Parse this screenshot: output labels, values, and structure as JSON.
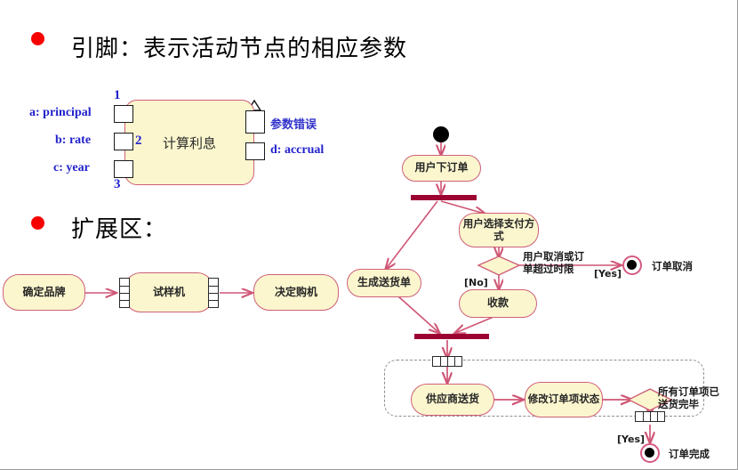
{
  "slide": {
    "heading_pin": "引脚：表示活动节点的相应参数",
    "heading_region": "扩展区："
  },
  "colors": {
    "node_fill": "#fbf6ce",
    "node_border": "#cf5f78",
    "flow": "#cf5575",
    "bar": "#9c0232",
    "bullet": "#f80000",
    "pin_label": "#2222cc",
    "region_border": "#8e8e8e"
  },
  "pin_example": {
    "activity_label": "计算利息",
    "input_pins": [
      {
        "label": "a: principal",
        "number": "1",
        "icon": "arrow-right-icon"
      },
      {
        "label": "b: rate",
        "number": "2",
        "icon": "arrow-right-icon"
      },
      {
        "label": "c: year",
        "number": "3",
        "icon": "arrow-right-icon"
      }
    ],
    "output_pins": [
      {
        "label": "参数错误",
        "icon": "exception-pin-icon"
      },
      {
        "label": "d: accrual",
        "icon": "arrow-right-icon"
      }
    ]
  },
  "expansion_example": {
    "nodes": [
      {
        "label": "确定品牌"
      },
      {
        "label": "试样机"
      },
      {
        "label": "决定购机"
      }
    ]
  },
  "activity_diagram": {
    "initial_node": "initial-node-icon",
    "nodes": [
      {
        "id": "order",
        "label": "用户下订单"
      },
      {
        "id": "pay_select",
        "label": "用户选择支付方式"
      },
      {
        "id": "delivery_note",
        "label": "生成送货单"
      },
      {
        "id": "collect",
        "label": "收款"
      },
      {
        "id": "supplier_deliver",
        "label": "供应商送货"
      },
      {
        "id": "update_item",
        "label": "修改订单项状态"
      }
    ],
    "decisions": [
      {
        "id": "cancel_or_timeout",
        "note": "用户取消或订单超过时限",
        "note_line1": "用户取消或订",
        "note_line2": "单超过时限",
        "yes": "[Yes]",
        "no": "[No]"
      },
      {
        "id": "all_delivered",
        "note": "所有订单项已送货完毕",
        "note_line1": "所有订单项已",
        "note_line2": "送货完毕",
        "yes": "[Yes]"
      }
    ],
    "final_nodes": [
      {
        "id": "order_cancelled",
        "label": "订单取消"
      },
      {
        "id": "order_complete",
        "label": "订单完成"
      }
    ],
    "bars": [
      {
        "id": "fork-bar",
        "kind": "fork"
      },
      {
        "id": "join-bar",
        "kind": "join"
      }
    ],
    "expansion_region": {
      "label": ""
    }
  }
}
